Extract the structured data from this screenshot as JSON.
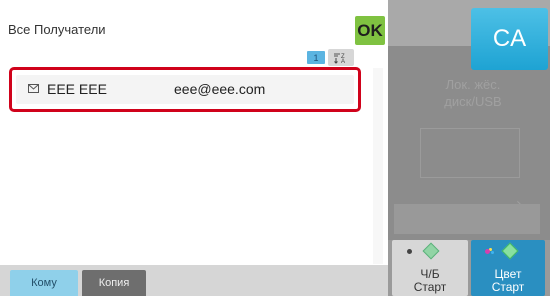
{
  "dialog": {
    "title": "Все Получатели",
    "ok_label": "OK",
    "page_number": "1"
  },
  "recipients": [
    {
      "name": "EEE EEE",
      "email": "eee@eee.com",
      "icon": "mail-icon"
    }
  ],
  "tabs": [
    {
      "label": "Кому",
      "active": true
    },
    {
      "label": "Копия",
      "active": false
    }
  ],
  "clear_all": {
    "label": "CA"
  },
  "background": {
    "storage_line1": "Лок. жёс.",
    "storage_line2": "диск/USB"
  },
  "start_buttons": {
    "bw": {
      "line1": "Ч/Б",
      "line2": "Старт"
    },
    "color": {
      "line1": "Цвет",
      "line2": "Старт"
    }
  },
  "colors": {
    "ok_button": "#7fc241",
    "ca_button": "#1ea3d3",
    "selection_border": "#d0021b",
    "active_tab": "#8fd0ea",
    "color_start": "#2a8fc1"
  }
}
